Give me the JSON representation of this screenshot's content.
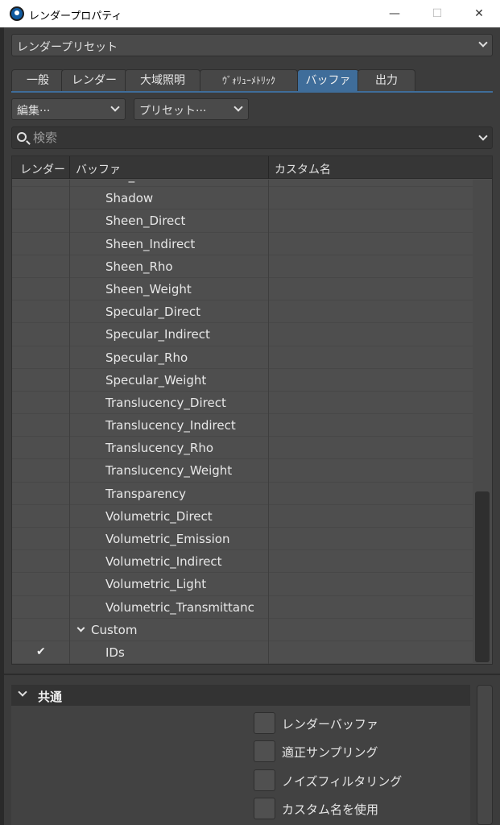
{
  "window": {
    "title": "レンダープロパティ",
    "controls": {
      "minimize": "—",
      "maximize": "☐",
      "close": "✕"
    }
  },
  "preset": {
    "label": "レンダープリセット"
  },
  "tabs": [
    {
      "label": "一般",
      "active": false
    },
    {
      "label": "レンダー",
      "active": false
    },
    {
      "label": "大域照明",
      "active": false
    },
    {
      "label": "ｳﾞｫﾘｭｰﾒﾄﾘｯｸ",
      "active": false
    },
    {
      "label": "バッファ",
      "active": true
    },
    {
      "label": "出力",
      "active": false
    }
  ],
  "dropdowns": {
    "edit": "編集···",
    "presets": "プリセット···"
  },
  "search": {
    "placeholder": "検索",
    "value": ""
  },
  "table": {
    "columns": [
      "レンダー",
      "バッファ",
      "カスタム名"
    ],
    "rows": [
      {
        "name": "SSS_Indirect",
        "checked": false,
        "group": false
      },
      {
        "name": "Shadow",
        "checked": false,
        "group": false
      },
      {
        "name": "Sheen_Direct",
        "checked": false,
        "group": false
      },
      {
        "name": "Sheen_Indirect",
        "checked": false,
        "group": false
      },
      {
        "name": "Sheen_Rho",
        "checked": false,
        "group": false
      },
      {
        "name": "Sheen_Weight",
        "checked": false,
        "group": false
      },
      {
        "name": "Specular_Direct",
        "checked": false,
        "group": false
      },
      {
        "name": "Specular_Indirect",
        "checked": false,
        "group": false
      },
      {
        "name": "Specular_Rho",
        "checked": false,
        "group": false
      },
      {
        "name": "Specular_Weight",
        "checked": false,
        "group": false
      },
      {
        "name": "Translucency_Direct",
        "checked": false,
        "group": false
      },
      {
        "name": "Translucency_Indirect",
        "checked": false,
        "group": false
      },
      {
        "name": "Translucency_Rho",
        "checked": false,
        "group": false
      },
      {
        "name": "Translucency_Weight",
        "checked": false,
        "group": false
      },
      {
        "name": "Transparency",
        "checked": false,
        "group": false
      },
      {
        "name": "Volumetric_Direct",
        "checked": false,
        "group": false
      },
      {
        "name": "Volumetric_Emission",
        "checked": false,
        "group": false
      },
      {
        "name": "Volumetric_Indirect",
        "checked": false,
        "group": false
      },
      {
        "name": "Volumetric_Light",
        "checked": false,
        "group": false
      },
      {
        "name": "Volumetric_Transmittanc",
        "checked": false,
        "group": false
      },
      {
        "name": "Custom",
        "checked": false,
        "group": true
      },
      {
        "name": "IDs",
        "checked": true,
        "group": false
      }
    ],
    "check_glyph": "✔"
  },
  "common": {
    "title": "共通",
    "options": [
      {
        "label": "レンダーバッファ",
        "checked": false
      },
      {
        "label": "適正サンプリング",
        "checked": false
      },
      {
        "label": "ノイズフィルタリング",
        "checked": false
      },
      {
        "label": "カスタム名を使用",
        "checked": false
      }
    ]
  },
  "colors": {
    "accent": "#3f6d9a",
    "panel": "#3c3c3c",
    "table": "#4e4e4e"
  }
}
